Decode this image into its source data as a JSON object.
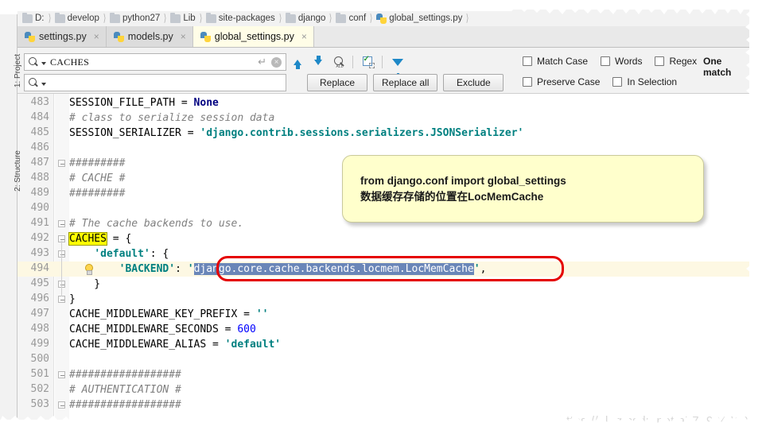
{
  "window": {
    "breadcrumb": [
      {
        "label": "D:",
        "icon": "drive-icon"
      },
      {
        "label": "develop",
        "icon": "folder-icon"
      },
      {
        "label": "python27",
        "icon": "folder-icon"
      },
      {
        "label": "Lib",
        "icon": "folder-icon"
      },
      {
        "label": "site-packages",
        "icon": "folder-icon"
      },
      {
        "label": "django",
        "icon": "folder-icon"
      },
      {
        "label": "conf",
        "icon": "folder-icon"
      },
      {
        "label": "global_settings.py",
        "icon": "python-file-icon"
      }
    ]
  },
  "left_rail": {
    "tabs": [
      {
        "label": "1: Project"
      },
      {
        "label": "2: Structure"
      }
    ]
  },
  "tabs": [
    {
      "label": "settings.py",
      "active": false,
      "close": "×"
    },
    {
      "label": "models.py",
      "active": false,
      "close": "×"
    },
    {
      "label": "global_settings.py",
      "active": true,
      "close": "×"
    }
  ],
  "find": {
    "search_value": "CACHES",
    "search_placeholder": "",
    "replace_value": "",
    "replace_placeholder": "",
    "enter_icon": "↵",
    "clear_icon": "×",
    "toolbar": [
      {
        "name": "find-previous-icon",
        "title": "Find Previous"
      },
      {
        "name": "find-next-icon",
        "title": "Find Next"
      },
      {
        "name": "find-all-icon",
        "title": "Find All"
      },
      {
        "name": "select-all-occurrences-icon",
        "title": "Select All Occurrences"
      },
      {
        "name": "filter-icon",
        "title": "Filter"
      }
    ],
    "buttons": [
      {
        "label": "Replace",
        "name": "replace-button"
      },
      {
        "label": "Replace all",
        "name": "replace-all-button"
      },
      {
        "label": "Exclude",
        "name": "exclude-button"
      }
    ],
    "options_row1": [
      {
        "label": "Match Case",
        "checked": false
      },
      {
        "label": "Words",
        "checked": false
      },
      {
        "label": "Regex",
        "checked": false
      }
    ],
    "options_row2": [
      {
        "label": "Preserve Case",
        "checked": false
      },
      {
        "label": "In Selection",
        "checked": false
      }
    ],
    "match_count": "One match"
  },
  "editor": {
    "first_line": 483,
    "lines": [
      {
        "n": 483,
        "segments": [
          {
            "t": "SESSION_FILE_PATH = ",
            "c": "s-plain"
          },
          {
            "t": "None",
            "c": "s-none"
          }
        ]
      },
      {
        "n": 484,
        "segments": [
          {
            "t": "# class to serialize session data",
            "c": "s-com"
          }
        ]
      },
      {
        "n": 485,
        "segments": [
          {
            "t": "SESSION_SERIALIZER = ",
            "c": "s-plain"
          },
          {
            "t": "'django.contrib.sessions.serializers.JSONSerializer'",
            "c": "s-str"
          }
        ]
      },
      {
        "n": 486,
        "segments": []
      },
      {
        "n": 487,
        "segments": [
          {
            "t": "#########",
            "c": "s-com"
          }
        ]
      },
      {
        "n": 488,
        "segments": [
          {
            "t": "# CACHE #",
            "c": "s-com"
          }
        ]
      },
      {
        "n": 489,
        "segments": [
          {
            "t": "#########",
            "c": "s-com"
          }
        ]
      },
      {
        "n": 490,
        "segments": []
      },
      {
        "n": 491,
        "segments": [
          {
            "t": "# The cache backends to use.",
            "c": "s-com"
          }
        ]
      },
      {
        "n": 492,
        "segments": [
          {
            "t": "CACHES",
            "c": "hl-yellow"
          },
          {
            "t": " = {",
            "c": "s-plain"
          }
        ]
      },
      {
        "n": 493,
        "segments": [
          {
            "t": "    ",
            "c": "s-plain"
          },
          {
            "t": "'default'",
            "c": "s-str"
          },
          {
            "t": ": {",
            "c": "s-plain"
          }
        ]
      },
      {
        "n": 494,
        "segments": [
          {
            "t": "        ",
            "c": "s-plain"
          },
          {
            "t": "'BACKEND'",
            "c": "s-str"
          },
          {
            "t": ": ",
            "c": "s-plain"
          },
          {
            "t": "'",
            "c": "s-str"
          },
          {
            "t": "django.core.cache.backends.locmem.LocMemCache",
            "c": "sel-blue"
          },
          {
            "t": "'",
            "c": "s-str"
          },
          {
            "t": ",",
            "c": "s-plain"
          }
        ]
      },
      {
        "n": 495,
        "segments": [
          {
            "t": "    }",
            "c": "s-plain"
          }
        ]
      },
      {
        "n": 496,
        "segments": [
          {
            "t": "}",
            "c": "s-plain"
          }
        ]
      },
      {
        "n": 497,
        "segments": [
          {
            "t": "CACHE_MIDDLEWARE_KEY_PREFIX = ",
            "c": "s-plain"
          },
          {
            "t": "''",
            "c": "s-str"
          }
        ]
      },
      {
        "n": 498,
        "segments": [
          {
            "t": "CACHE_MIDDLEWARE_SECONDS = ",
            "c": "s-plain"
          },
          {
            "t": "600",
            "c": "s-num"
          }
        ]
      },
      {
        "n": 499,
        "segments": [
          {
            "t": "CACHE_MIDDLEWARE_ALIAS = ",
            "c": "s-plain"
          },
          {
            "t": "'default'",
            "c": "s-str"
          }
        ]
      },
      {
        "n": 500,
        "segments": []
      },
      {
        "n": 501,
        "segments": [
          {
            "t": "##################",
            "c": "s-com"
          }
        ]
      },
      {
        "n": 502,
        "segments": [
          {
            "t": "# AUTHENTICATION #",
            "c": "s-com"
          }
        ]
      },
      {
        "n": 503,
        "segments": [
          {
            "t": "##################",
            "c": "s-com"
          }
        ]
      }
    ],
    "highlighted_line": 494,
    "gutter_icon": "lightbulb-icon"
  },
  "note": {
    "line1": "from django.conf import global_settings",
    "line2": "数据缓存存储的位置在LocMemCache"
  },
  "watermark": "https://blog.csdn.net/a772904419",
  "colors": {
    "accent_blue": "#1e88c7",
    "annotation_red": "#e50000",
    "note_yellow": "#ffffcc",
    "highlight_yellow": "#ffff00",
    "selection_blue": "#6a86b8",
    "string_teal": "#008080",
    "comment_gray": "#808080"
  }
}
